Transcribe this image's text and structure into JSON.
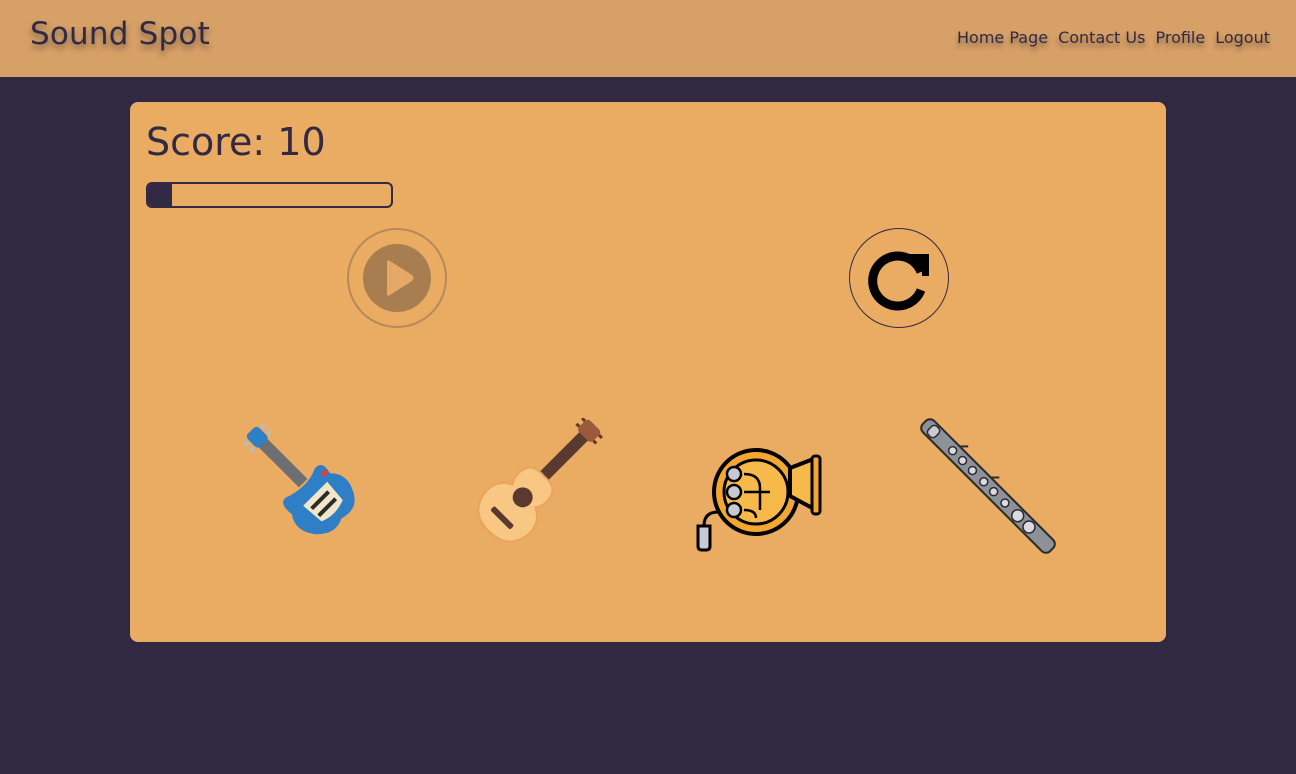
{
  "app": {
    "title": "Sound Spot"
  },
  "nav": {
    "items": [
      {
        "label": "Home Page"
      },
      {
        "label": "Contact Us"
      },
      {
        "label": "Profile"
      },
      {
        "label": "Logout"
      }
    ]
  },
  "game": {
    "score_text": "Score: 10",
    "progress_percent": 10,
    "play_button_icon": "play-icon",
    "replay_button_icon": "redo-icon",
    "instruments": [
      {
        "icon": "electric-guitar-icon"
      },
      {
        "icon": "acoustic-guitar-icon"
      },
      {
        "icon": "french-horn-icon"
      },
      {
        "icon": "flute-icon"
      }
    ]
  },
  "colors": {
    "header_bg": "#d6a066",
    "page_bg": "#322a43",
    "card_bg": "#eaab62",
    "text": "#322a43"
  }
}
